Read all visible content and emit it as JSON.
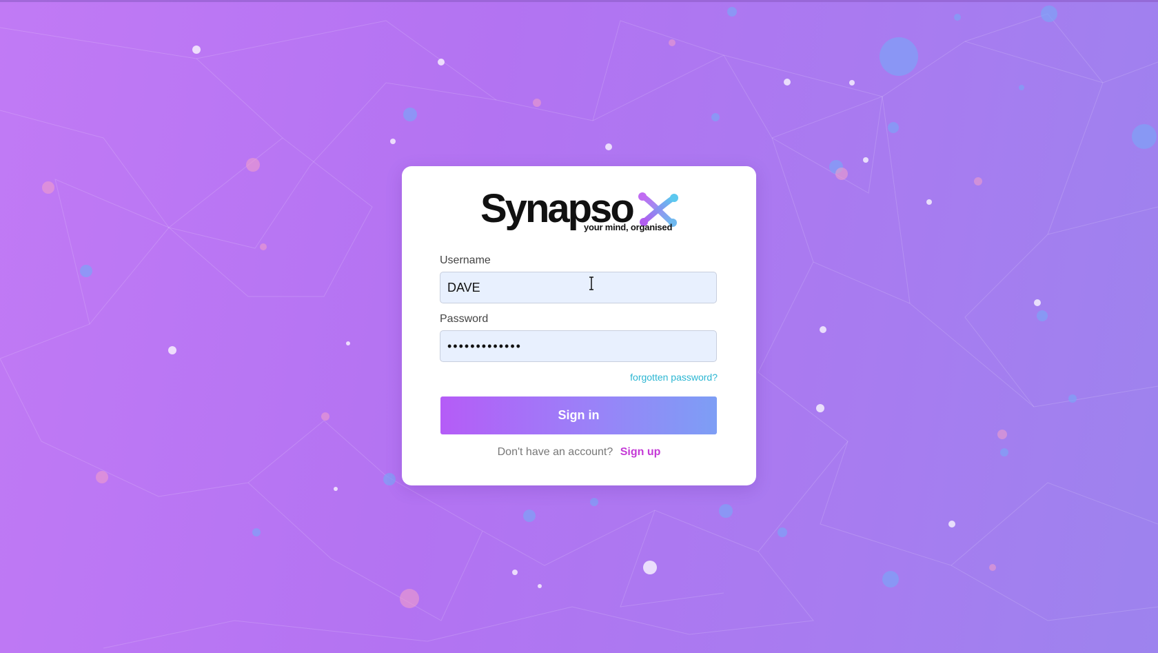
{
  "brand": {
    "name": "Synapso",
    "tagline": "your mind, organised"
  },
  "form": {
    "username_label": "Username",
    "username_value": "DAVE",
    "password_label": "Password",
    "password_value": "•••••••••••••",
    "forgot_label": "forgotten password?",
    "signin_label": "Sign in",
    "signup_prompt": "Don't have an account?",
    "signup_label": "Sign up"
  },
  "colors": {
    "background": "#b373f2",
    "button_start": "#b55cf7",
    "button_end": "#7d9ef5",
    "forgot_link": "#2bb6d2",
    "signup_link": "#c43ad6",
    "input_fill": "#e8f0fe"
  },
  "icons": {
    "logo_mark": "synapse-x-icon",
    "cursor": "text-cursor-icon"
  }
}
